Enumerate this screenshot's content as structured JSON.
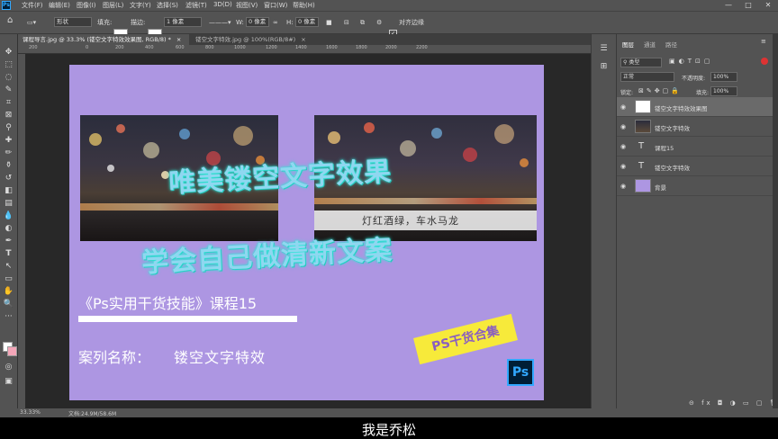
{
  "menubar": {
    "logo": "Ps",
    "items": [
      "文件(F)",
      "编辑(E)",
      "图像(I)",
      "图层(L)",
      "文字(Y)",
      "选择(S)",
      "滤镜(T)",
      "3D(D)",
      "视图(V)",
      "窗口(W)",
      "帮助(H)"
    ],
    "minimize": "—",
    "maximize": "□",
    "close": "✕"
  },
  "options": {
    "shape_mode": "形状",
    "fill_label": "填充:",
    "stroke_label": "描边:",
    "stroke_size": "1 像素",
    "w_label": "W:",
    "w_value": "0 像素",
    "h_label": "H:",
    "h_value": "0 像素",
    "align_edges": "对齐边缘"
  },
  "tabs": [
    {
      "label": "课程导言.jpg @ 33.3% (镂空文字特效效果图, RGB/8) *",
      "close": "×"
    },
    {
      "label": "镂空文字特效.jpg @ 100%(RGB/8#)",
      "close": "×"
    }
  ],
  "ruler_ticks": [
    "200",
    "0",
    "200",
    "400",
    "600",
    "800",
    "1000",
    "1200",
    "1400",
    "1600",
    "1800",
    "2000",
    "2200"
  ],
  "artwork": {
    "headline": "唯美镂空文字效果",
    "caption": "灯红酒绿，车水马龙",
    "subheadline": "学会自己做清新文案",
    "course_title": "《Ps实用干货技能》课程15",
    "case_label": "案列名称：",
    "case_name": "镂空文字特效",
    "badge": "PS干货合集",
    "ps_logo": "Ps"
  },
  "panel": {
    "tabs": [
      "图层",
      "通道",
      "路径"
    ],
    "filter_kind": "类型",
    "blend_mode": "正常",
    "opacity_label": "不透明度:",
    "opacity_value": "100%",
    "lock_label": "锁定:",
    "fill_label": "填充:",
    "fill_value": "100%",
    "layers": [
      {
        "name": "镂空文字特效效果图",
        "selected": true
      },
      {
        "name": "镂空文字特效"
      },
      {
        "name": "课程15",
        "type_layer": "T"
      },
      {
        "name": "镂空文字特效",
        "type_layer": "T"
      },
      {
        "name": "背景"
      }
    ],
    "footer_icons": "⊝ fx ◘ ◑ ▭ ▢ 🗑"
  },
  "status": {
    "zoom": "33.33%",
    "doc": "文档:24.9M/58.6M"
  },
  "subtitle": "我是乔松",
  "colors": {
    "artboard": "#ad96e2",
    "headline_fill": "#8fd7f0",
    "headline_glow": "#30e8d8",
    "badge": "#f7ea3a",
    "ps_blue": "#31a8ff"
  }
}
